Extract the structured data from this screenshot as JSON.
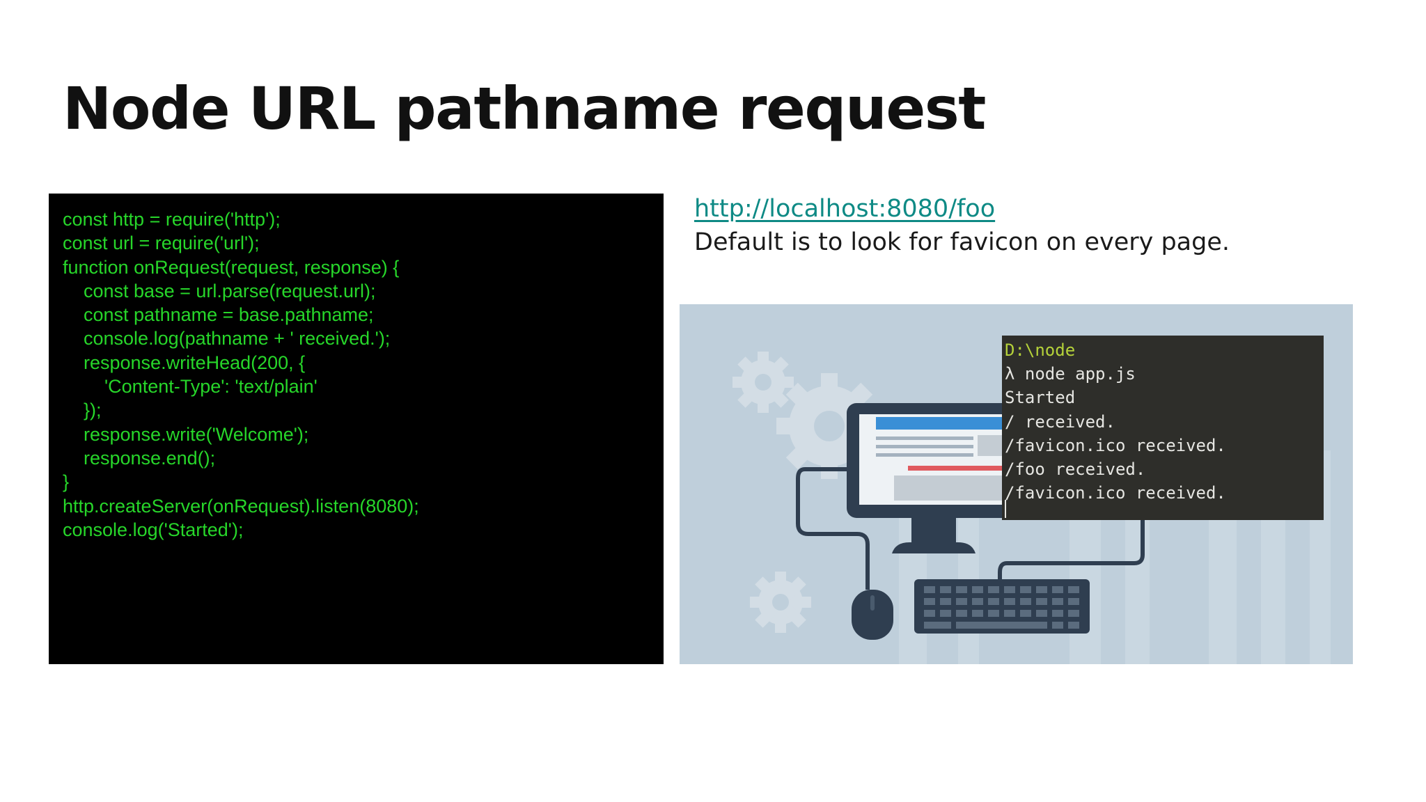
{
  "slide": {
    "title": "Node URL pathname request"
  },
  "code": {
    "lines": [
      "const http = require('http');",
      "const url = require('url');",
      "function onRequest(request, response) {",
      "    const base = url.parse(request.url);",
      "    const pathname = base.pathname;",
      "    console.log(pathname + ' received.');",
      "    response.writeHead(200, {",
      "        'Content-Type': 'text/plain'",
      "    });",
      "    response.write('Welcome');",
      "    response.end();",
      "}",
      "http.createServer(onRequest).listen(8080);",
      "console.log('Started');"
    ]
  },
  "notes": {
    "link": "http://localhost:8080/foo",
    "description": "Default is to look for favicon on every page."
  },
  "terminal": {
    "lines": [
      "D:\\node",
      "λ node app.js",
      "Started",
      "/ received.",
      "/favicon.ico received.",
      "/foo received.",
      "/favicon.ico received."
    ]
  },
  "colors": {
    "code_text": "#27d62a",
    "code_background": "#000000",
    "link": "#0e8a85",
    "illustration_background": "#bfcfdb",
    "terminal_background": "#2e2e2a",
    "terminal_path": "#b5d23a"
  },
  "icons": [
    "gear-icon",
    "monitor-icon",
    "keyboard-icon",
    "mouse-icon"
  ]
}
